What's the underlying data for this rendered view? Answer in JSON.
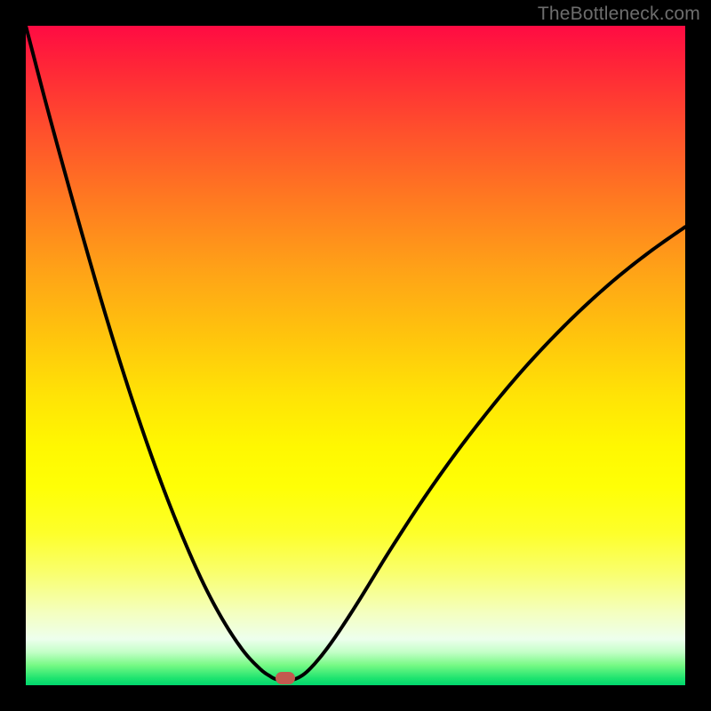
{
  "watermark": "TheBottleneck.com",
  "marker": {
    "x_frac": 0.393,
    "y_frac": 0.989
  },
  "chart_data": {
    "type": "line",
    "title": "",
    "xlabel": "",
    "ylabel": "",
    "xlim": [
      0,
      1
    ],
    "ylim": [
      0,
      1
    ],
    "series": [
      {
        "name": "curve",
        "x": [
          0.0,
          0.03,
          0.06,
          0.09,
          0.12,
          0.15,
          0.18,
          0.21,
          0.24,
          0.27,
          0.3,
          0.33,
          0.355,
          0.37,
          0.38,
          0.393,
          0.41,
          0.43,
          0.46,
          0.5,
          0.55,
          0.6,
          0.65,
          0.7,
          0.75,
          0.8,
          0.85,
          0.9,
          0.95,
          1.0
        ],
        "y": [
          1.0,
          0.885,
          0.775,
          0.668,
          0.565,
          0.468,
          0.378,
          0.295,
          0.22,
          0.153,
          0.097,
          0.052,
          0.025,
          0.014,
          0.009,
          0.008,
          0.01,
          0.024,
          0.06,
          0.12,
          0.201,
          0.278,
          0.349,
          0.414,
          0.474,
          0.528,
          0.577,
          0.621,
          0.66,
          0.695
        ]
      }
    ],
    "gradient_stops": [
      {
        "pos": 0.0,
        "color": "#ff0b43"
      },
      {
        "pos": 0.56,
        "color": "#ffe306"
      },
      {
        "pos": 0.89,
        "color": "#f4ffbf"
      },
      {
        "pos": 1.0,
        "color": "#00d66d"
      }
    ]
  }
}
